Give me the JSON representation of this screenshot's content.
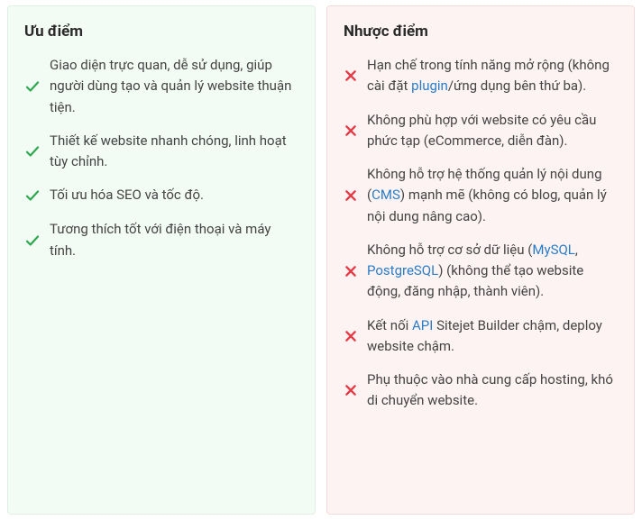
{
  "pros": {
    "title": "Ưu điểm",
    "items": [
      {
        "text": "Giao diện trực quan, dễ sử dụng, giúp người dùng tạo và quản lý website thuận tiện."
      },
      {
        "text": "Thiết kế website nhanh chóng, linh hoạt tùy chỉnh."
      },
      {
        "text": "Tối ưu hóa SEO và tốc độ."
      },
      {
        "text": "Tương thích tốt với điện thoại và máy tính."
      }
    ]
  },
  "cons": {
    "title": "Nhược điểm",
    "items": [
      {
        "segments": [
          {
            "text": "Hạn chế trong tính năng mở rộng (không cài đặt "
          },
          {
            "text": "plugin",
            "link": true
          },
          {
            "text": "/ứng dụng bên thứ ba)."
          }
        ]
      },
      {
        "segments": [
          {
            "text": "Không phù hợp với website có yêu cầu phức tạp (eCommerce, diễn đàn)."
          }
        ]
      },
      {
        "segments": [
          {
            "text": "Không hỗ trợ hệ thống quản lý nội dung ("
          },
          {
            "text": "CMS",
            "link": true
          },
          {
            "text": ") mạnh mẽ (không có blog, quản lý nội dung nâng cao)."
          }
        ]
      },
      {
        "segments": [
          {
            "text": "Không hỗ trợ cơ sở dữ liệu ("
          },
          {
            "text": "MySQL",
            "link": true
          },
          {
            "text": ", "
          },
          {
            "text": "PostgreSQL",
            "link": true
          },
          {
            "text": ") (không thể tạo website động, đăng nhập, thành viên)."
          }
        ]
      },
      {
        "segments": [
          {
            "text": "Kết nối "
          },
          {
            "text": "API",
            "link": true
          },
          {
            "text": " Sitejet Builder chậm, deploy website chậm."
          }
        ]
      },
      {
        "segments": [
          {
            "text": "Phụ thuộc vào nhà cung cấp hosting, khó di chuyển website."
          }
        ]
      }
    ]
  },
  "colors": {
    "check": "#2fa84f",
    "cross": "#e63946",
    "link": "#2a7cc7"
  }
}
